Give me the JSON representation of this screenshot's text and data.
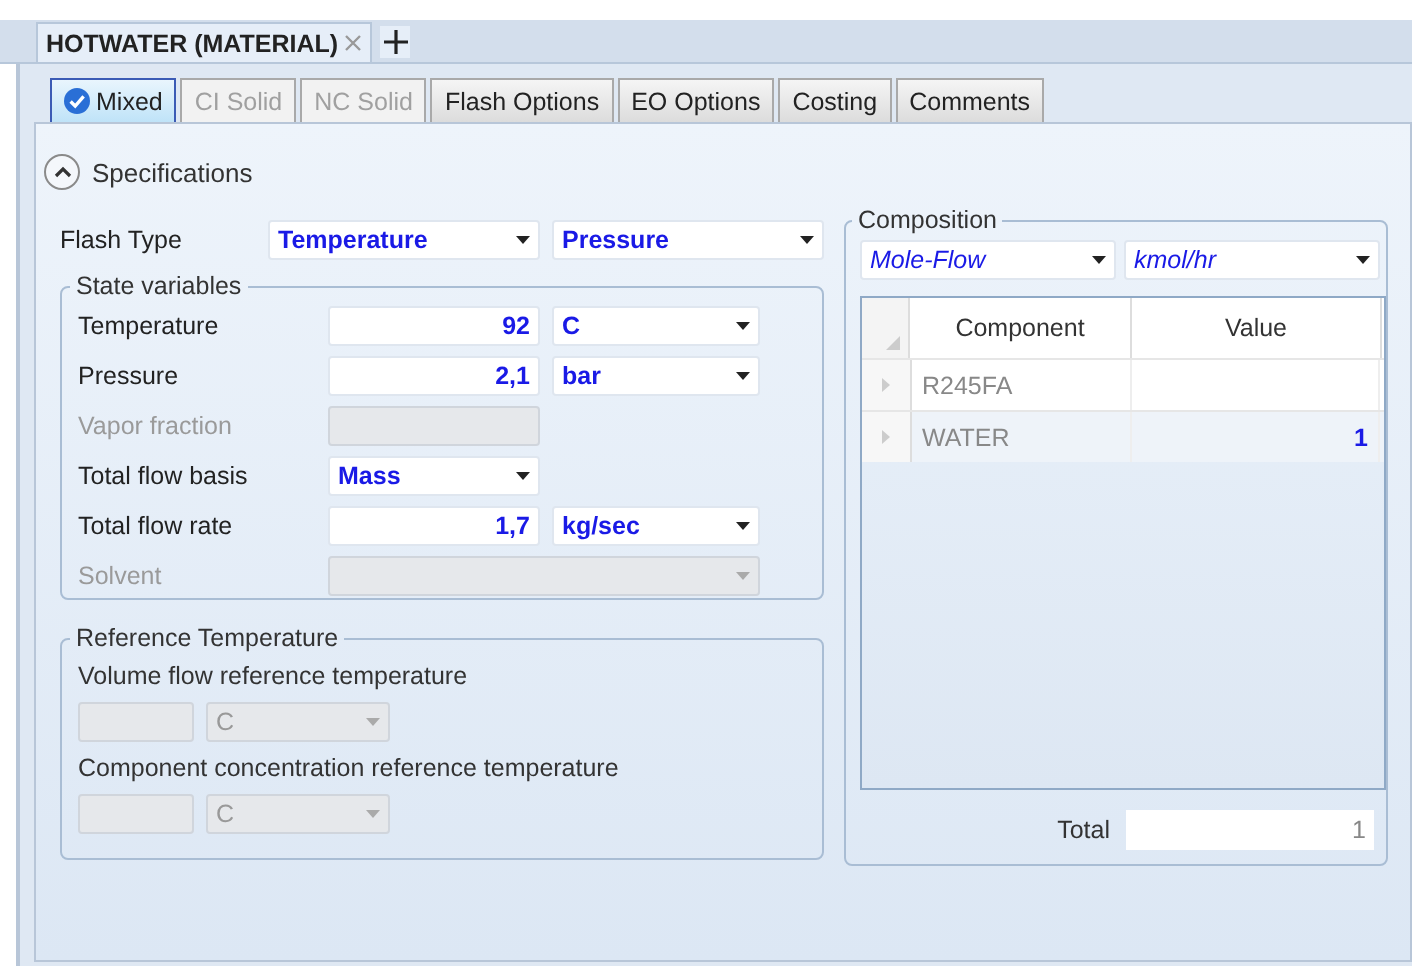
{
  "document_tab": {
    "title": "HOTWATER (MATERIAL)"
  },
  "tabs": [
    {
      "label": "Mixed",
      "selected": true,
      "disabled": false,
      "complete": true
    },
    {
      "label": "CI Solid",
      "selected": false,
      "disabled": true,
      "complete": false
    },
    {
      "label": "NC Solid",
      "selected": false,
      "disabled": true,
      "complete": false
    },
    {
      "label": "Flash Options",
      "selected": false,
      "disabled": false,
      "complete": false
    },
    {
      "label": "EO Options",
      "selected": false,
      "disabled": false,
      "complete": false
    },
    {
      "label": "Costing",
      "selected": false,
      "disabled": false,
      "complete": false
    },
    {
      "label": "Comments",
      "selected": false,
      "disabled": false,
      "complete": false
    }
  ],
  "specifications": {
    "label": "Specifications",
    "expanded": true
  },
  "flash_type": {
    "label": "Flash Type",
    "first": "Temperature",
    "second": "Pressure"
  },
  "state_variables": {
    "title": "State variables",
    "rows": [
      {
        "kind": "value_unit",
        "label": "Temperature",
        "value": "92",
        "unit": "C",
        "disabled": false
      },
      {
        "kind": "value_unit",
        "label": "Pressure",
        "value": "2,1",
        "unit": "bar",
        "disabled": false
      },
      {
        "kind": "value",
        "label": "Vapor fraction",
        "disabled": true
      },
      {
        "kind": "select",
        "label": "Total flow basis",
        "value": "Mass",
        "disabled": false
      },
      {
        "kind": "value_unit",
        "label": "Total flow rate",
        "value": "1,7",
        "unit": "kg/sec",
        "disabled": false
      },
      {
        "kind": "wide_select",
        "label": "Solvent",
        "disabled": true
      }
    ]
  },
  "reference_temperature": {
    "title": "Reference Temperature",
    "items": [
      {
        "label": "Volume flow reference temperature",
        "unit": "C"
      },
      {
        "label": "Component concentration reference temperature",
        "unit": "C"
      }
    ]
  },
  "composition": {
    "title": "Composition",
    "basis": "Mole-Flow",
    "units": "kmol/hr",
    "columns": [
      "Component",
      "Value"
    ],
    "rows": [
      {
        "component": "R245FA",
        "selected": false
      },
      {
        "component": "WATER",
        "value": "1",
        "selected": true
      }
    ],
    "total_label": "Total",
    "total": "1"
  }
}
